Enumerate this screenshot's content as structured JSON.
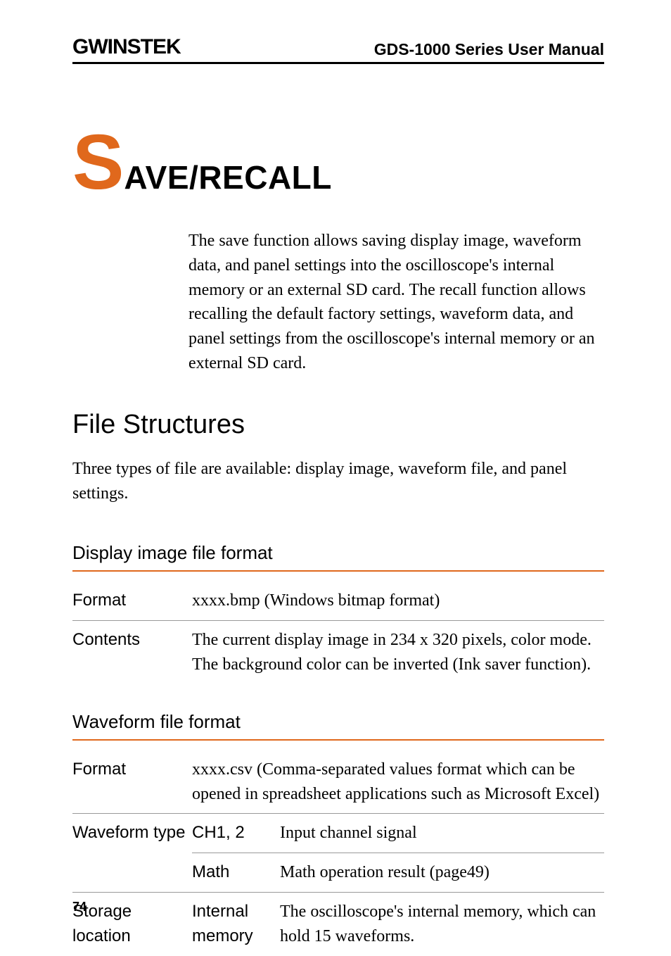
{
  "header": {
    "logo": "GWINSTEK",
    "title": "GDS-1000 Series User Manual"
  },
  "chapter": {
    "first_letter": "S",
    "rest": "AVE/RECALL",
    "intro": "The save function allows saving display image, waveform data, and panel settings into the oscilloscope's internal memory or an external SD card. The recall function allows recalling the default factory settings, waveform data, and panel settings from the oscilloscope's internal memory or an external SD card."
  },
  "section": {
    "heading": "File Structures",
    "intro": "Three types of file are available: display image, waveform file, and panel settings."
  },
  "display_image": {
    "heading": "Display image file format",
    "rows": [
      {
        "label": "Format",
        "value": "xxxx.bmp (Windows bitmap format)"
      },
      {
        "label": "Contents",
        "value": "The current display image in 234 x 320 pixels, color mode. The background color can be inverted (Ink saver function)."
      }
    ]
  },
  "waveform": {
    "heading": "Waveform file format",
    "format": {
      "label": "Format",
      "value": "xxxx.csv (Comma-separated values format which can be opened in spreadsheet applications such as Microsoft Excel)"
    },
    "waveform_type": {
      "label": "Waveform type",
      "entries": [
        {
          "sub": "CH1, 2",
          "value": "Input channel signal"
        },
        {
          "sub": "Math",
          "value": "Math operation result (page49)"
        }
      ]
    },
    "storage_location": {
      "label": "Storage location",
      "entries": [
        {
          "sub": "Internal memory",
          "value": "The oscilloscope's internal memory, which can hold 15 waveforms."
        }
      ]
    }
  },
  "page_number": "74"
}
